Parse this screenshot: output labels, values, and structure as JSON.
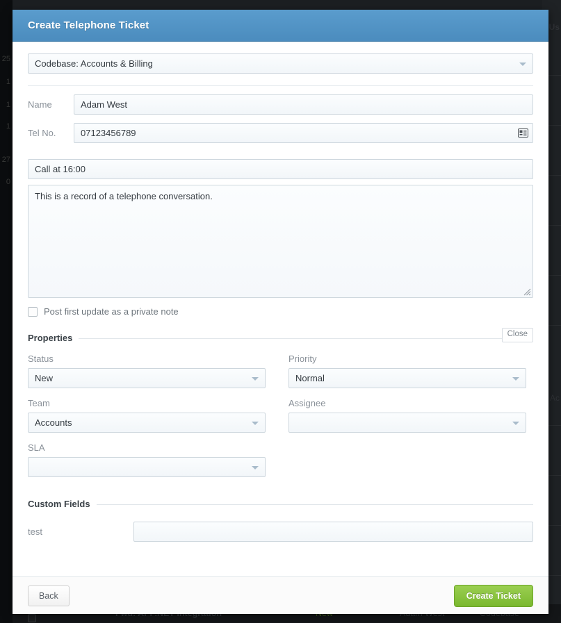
{
  "modal": {
    "title": "Create Telephone Ticket",
    "codebase": {
      "label_hidden": "Codebase",
      "value": "Codebase: Accounts & Billing",
      "arrow_icon": "chevron-down-icon"
    },
    "name": {
      "label": "Name",
      "value": "Adam West",
      "placeholder": ""
    },
    "tel": {
      "label": "Tel No.",
      "value": "07123456789",
      "placeholder": "",
      "icon": "contact-card-icon"
    },
    "subject": {
      "value": "Call at 16:00",
      "placeholder": ""
    },
    "body": {
      "value": "This is a record of a telephone conversation.",
      "placeholder": ""
    },
    "private_note": {
      "label": "Post first update as a private note",
      "checked": false
    },
    "properties": {
      "heading": "Properties",
      "close_label": "Close",
      "fields": [
        {
          "label": "Status",
          "value": "New"
        },
        {
          "label": "Priority",
          "value": "Normal"
        },
        {
          "label": "Team",
          "value": "Accounts"
        },
        {
          "label": "Assignee",
          "value": ""
        },
        {
          "label": "SLA",
          "value": ""
        }
      ]
    },
    "custom_fields": {
      "heading": "Custom Fields",
      "fields": [
        {
          "label": "test",
          "value": "",
          "placeholder": ""
        }
      ]
    },
    "footer": {
      "back_label": "Back",
      "create_label": "Create Ticket"
    }
  },
  "background": {
    "sidebar_numbers": [
      "25",
      "1",
      "1",
      "1",
      "27",
      "0"
    ],
    "right_labels": [
      "Us",
      "Ac"
    ],
    "bottom_row": {
      "subject": "Fwd: API .NET Integration",
      "status": "New",
      "user": "Adam West",
      "codebase": "Codebase"
    }
  },
  "colors": {
    "header_blue": "#4b8cbe",
    "create_green": "#7ab82f",
    "status_new": "#4c6b25"
  }
}
